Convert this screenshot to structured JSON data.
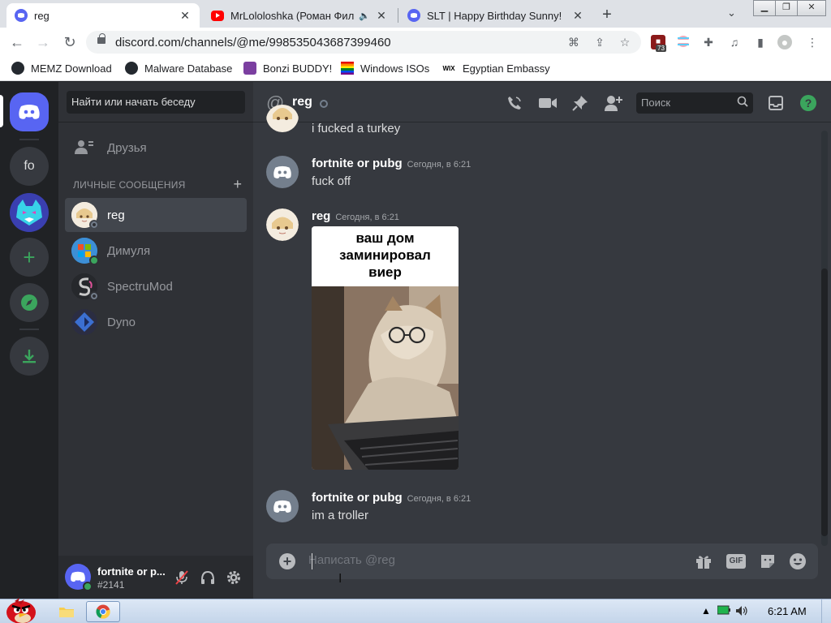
{
  "browser": {
    "tabs": [
      {
        "title": "reg",
        "active": true,
        "favicon": "discord-icon"
      },
      {
        "title": "MrLololoshka (Роман Фил",
        "active": false,
        "favicon": "youtube-icon"
      },
      {
        "title": "SLT | Happy Birthday Sunny!",
        "active": false,
        "favicon": "discord-icon"
      }
    ],
    "new_tab": "+",
    "url": "discord.com/channels/@me/998535043687399460",
    "extension_badge": "73",
    "bookmarks": [
      {
        "label": "MEMZ Download",
        "icon": "github-icon"
      },
      {
        "label": "Malware Database",
        "icon": "github-icon"
      },
      {
        "label": "Bonzi BUDDY!",
        "icon": "bonzi-icon"
      },
      {
        "label": "Windows ISOs",
        "icon": "pride-flag-icon"
      },
      {
        "label": "Egyptian Embassy",
        "icon": "wix-icon"
      }
    ],
    "wix_text": "WIX"
  },
  "guilds": [
    {
      "name": "home",
      "icon": "discord-logo-icon"
    },
    {
      "name": "fo",
      "label": "fo"
    },
    {
      "name": "mrbeast-gaming-server",
      "icon": "wolf-avatar-icon"
    },
    {
      "name": "add-server",
      "icon": "plus-icon"
    },
    {
      "name": "explore",
      "icon": "compass-icon"
    },
    {
      "name": "download",
      "icon": "download-icon"
    }
  ],
  "dm": {
    "search_placeholder": "Найти или начать беседу",
    "friends_label": "Друзья",
    "header": "ЛИЧНЫЕ СООБЩЕНИЯ",
    "items": [
      {
        "name": "reg",
        "selected": true,
        "status": "offline"
      },
      {
        "name": "Димуля",
        "selected": false,
        "status": "online"
      },
      {
        "name": "SpectruMod",
        "selected": false,
        "status": "offline"
      },
      {
        "name": "Dyno",
        "selected": false,
        "status": "none"
      }
    ]
  },
  "user": {
    "name": "fortnite or p...",
    "tag": "#2141"
  },
  "chat": {
    "channel": "reg",
    "search_placeholder": "Поиск",
    "messages": [
      {
        "author": "",
        "time": "",
        "text": "i fucked a turkey"
      },
      {
        "author": "fortnite or pubg",
        "time": "Сегодня, в 6:21",
        "text": "fuck off"
      },
      {
        "author": "reg",
        "time": "Сегодня, в 6:21",
        "text": ""
      },
      {
        "author": "fortnite or pubg",
        "time": "Сегодня, в 6:21",
        "text": "im a troller"
      }
    ],
    "meme_caption_lines": [
      "ваш дом",
      "заминировал",
      "виер"
    ],
    "composer_placeholder": "Написать @reg",
    "gif_label": "GIF"
  },
  "taskbar": {
    "clock": "6:21 AM"
  },
  "colors": {
    "blurple": "#5865f2",
    "online": "#3ba55d",
    "chat_bg": "#36393f",
    "sidebar_bg": "#2f3136",
    "guild_bg": "#202225"
  }
}
